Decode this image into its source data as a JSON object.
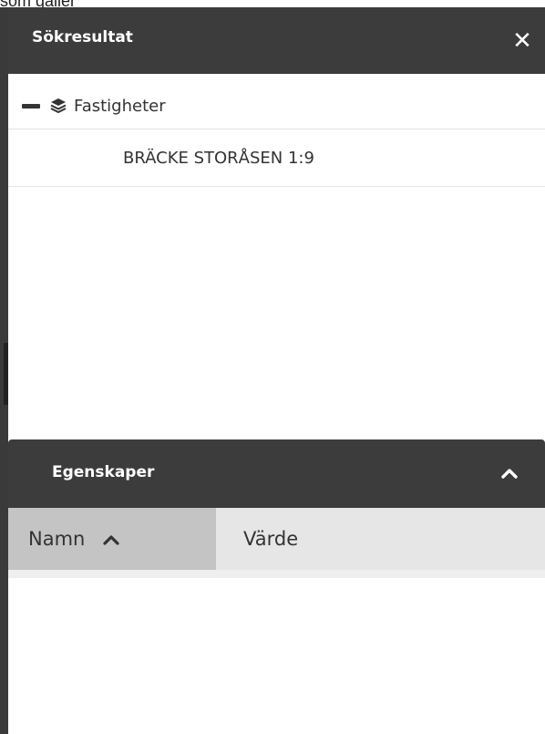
{
  "background": {
    "cropped_text": "som gäller"
  },
  "search_results": {
    "title": "Sökresultat",
    "close_symbol": "✕",
    "groups": [
      {
        "label": "Fastigheter",
        "icon": "layers-icon",
        "expanded": true,
        "items": [
          {
            "label": "BRÄCKE STORÅSEN 1:9"
          }
        ]
      }
    ]
  },
  "properties": {
    "title": "Egenskaper",
    "columns": [
      {
        "label": "Namn",
        "sort": "ascending"
      },
      {
        "label": "Värde"
      }
    ],
    "rows": []
  },
  "colors": {
    "header_bg": "#3c3c3c",
    "header_text": "#ffffff",
    "selected_column_bg": "#c4c4c4",
    "column_bg": "#e6e6e6"
  }
}
